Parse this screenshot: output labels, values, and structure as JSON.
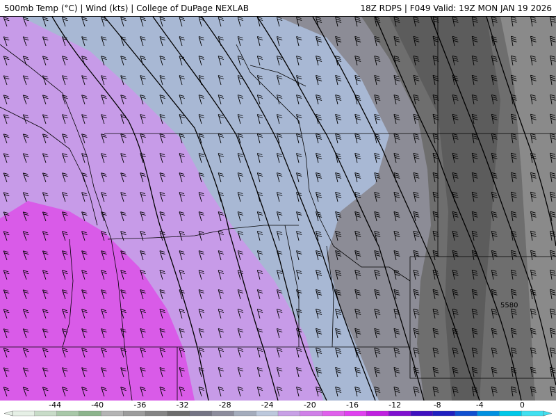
{
  "header": {
    "left_title": "500mb Temp (°C) | Wind (kts) | College of DuPage NEXLAB",
    "right_title": "18Z RDPS | F049 Valid: 19Z MON JAN 19 2026"
  },
  "map": {
    "contour_label": "5580"
  },
  "colorbar": {
    "ticks": [
      "-44",
      "-40",
      "-36",
      "-32",
      "-28",
      "-24",
      "-20",
      "-16",
      "-12",
      "-8",
      "-4",
      "0"
    ],
    "tick_values": [
      -44,
      -40,
      -36,
      -32,
      -28,
      -24,
      -20,
      -16,
      -12,
      -8,
      -4,
      0
    ],
    "range": [
      -48,
      2
    ],
    "colors": [
      "#e6f0e6",
      "#c8dcc8",
      "#a8c8a8",
      "#8cb48c",
      "#b4b4b4",
      "#9c9c9c",
      "#848484",
      "#6c6c6c",
      "#747484",
      "#8c8c9c",
      "#a4acbc",
      "#bcc8dc",
      "#c8a0e6",
      "#d080e8",
      "#e060ec",
      "#e040f0",
      "#c020e0",
      "#8010d0",
      "#4010c0",
      "#2020c0",
      "#1050d0",
      "#0090e0",
      "#00c8e8",
      "#40e0f0"
    ]
  },
  "colors": {
    "magenta": "#d95be8",
    "light_purple": "#c79be8",
    "blue_gray": "#a8b8d4",
    "mid_gray": "#7a7a7a",
    "dark_gray": "#5f5f5f",
    "light_gray": "#9a9a9a"
  }
}
